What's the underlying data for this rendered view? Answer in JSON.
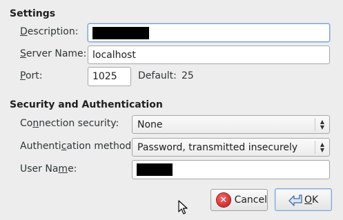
{
  "settings": {
    "title": "Settings",
    "description_label_u": "D",
    "description_label_rest": "escription:",
    "server_label_u": "S",
    "server_label_rest": "erver Name:",
    "server_value": "localhost",
    "port_label_u": "P",
    "port_label_rest": "ort:",
    "port_value": "1025",
    "default_label": "Default:",
    "default_value": "25"
  },
  "security": {
    "title": "Security and Authentication",
    "connection_label_a": "Co",
    "connection_label_u": "n",
    "connection_label_b": "nection security:",
    "connection_value": "None",
    "auth_label_a": "Authenti",
    "auth_label_u": "c",
    "auth_label_b": "ation method:",
    "auth_value": "Password, transmitted insecurely",
    "username_label_a": "User Na",
    "username_label_u": "m",
    "username_label_b": "e:"
  },
  "buttons": {
    "cancel_label": "Cancel",
    "ok_label_u": "O",
    "ok_label_rest": "K"
  },
  "icons": {
    "cancel": "cancel-icon",
    "ok": "ok-arrow-icon",
    "combo_arrows": "up-down-arrows-icon",
    "cursor": "mouse-pointer-icon"
  },
  "colors": {
    "background": "#ededed",
    "focus": "#7aa2d6",
    "cancel_red": "#c41414"
  }
}
